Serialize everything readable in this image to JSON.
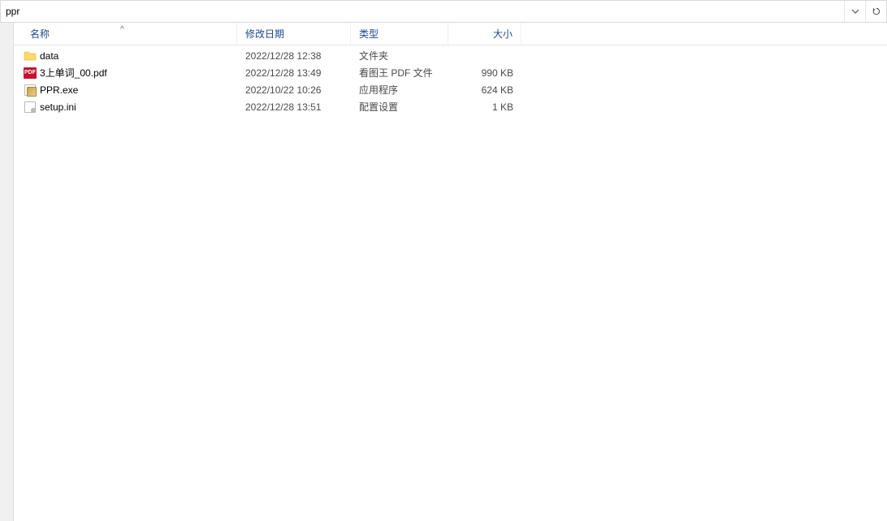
{
  "address": {
    "value": "ppr"
  },
  "sort_indicator": "^",
  "columns": {
    "name": "名称",
    "date": "修改日期",
    "type": "类型",
    "size": "大小"
  },
  "files": [
    {
      "icon": "folder",
      "name": "data",
      "date": "2022/12/28 12:38",
      "type": "文件夹",
      "size": ""
    },
    {
      "icon": "pdf",
      "name": "3上单词_00.pdf",
      "date": "2022/12/28 13:49",
      "type": "看图王 PDF 文件",
      "size": "990 KB"
    },
    {
      "icon": "exe",
      "name": "PPR.exe",
      "date": "2022/10/22 10:26",
      "type": "应用程序",
      "size": "624 KB"
    },
    {
      "icon": "ini",
      "name": "setup.ini",
      "date": "2022/12/28 13:51",
      "type": "配置设置",
      "size": "1 KB"
    }
  ]
}
